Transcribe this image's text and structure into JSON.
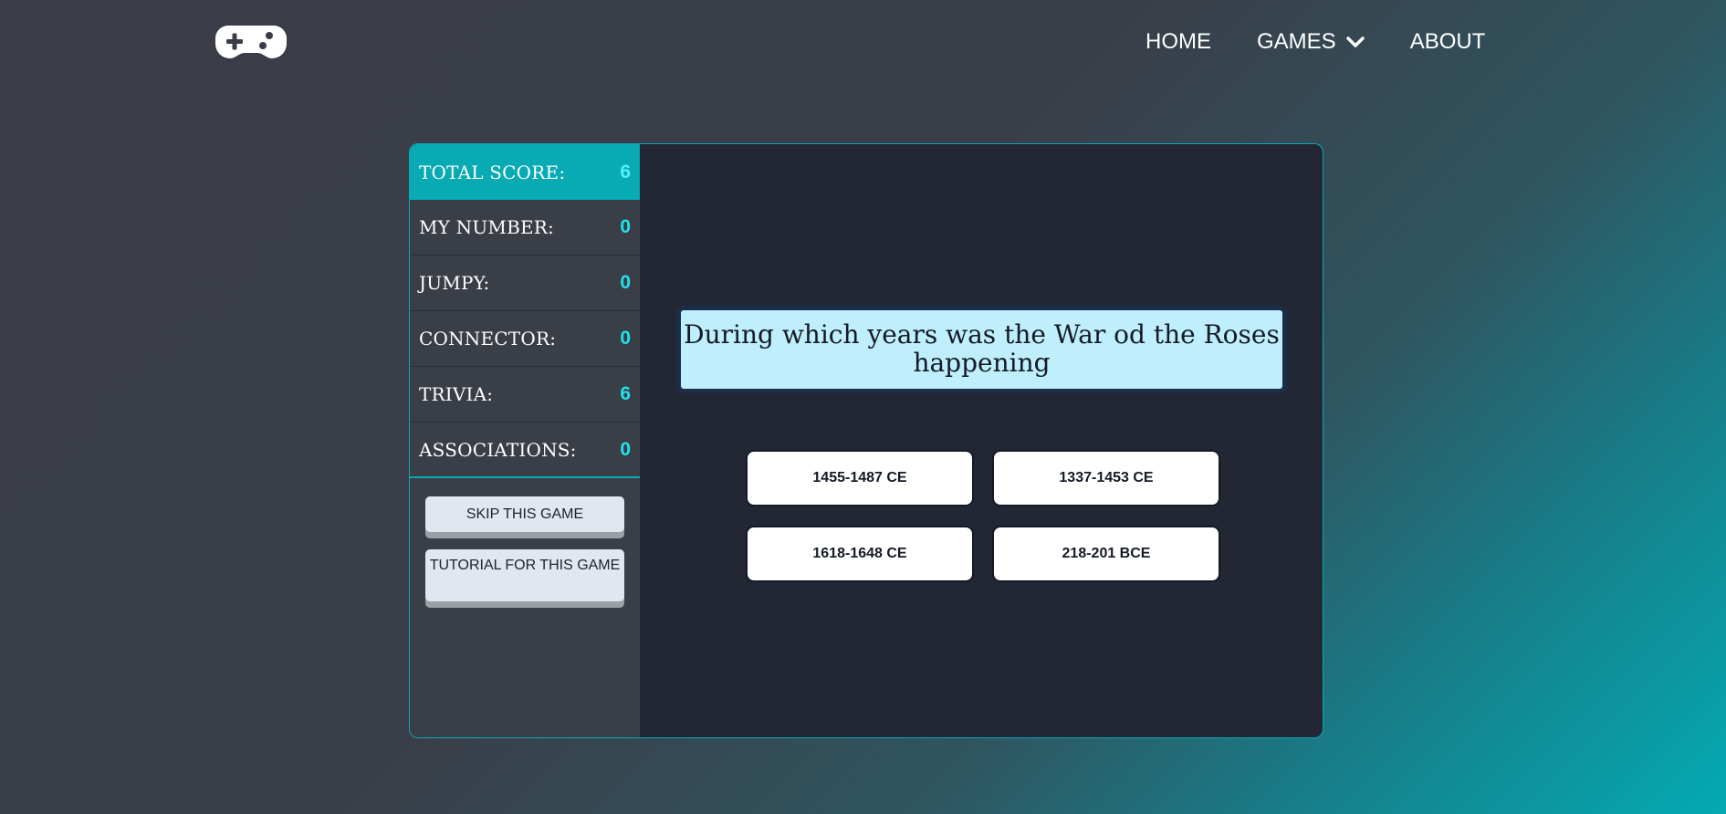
{
  "nav": {
    "home": "HOME",
    "games": "GAMES",
    "about": "ABOUT"
  },
  "scores": [
    {
      "label": "TOTAL SCORE:",
      "value": "6"
    },
    {
      "label": "MY NUMBER:",
      "value": "0"
    },
    {
      "label": "JUMPY:",
      "value": "0"
    },
    {
      "label": "CONNECTOR:",
      "value": "0"
    },
    {
      "label": "TRIVIA:",
      "value": "6"
    },
    {
      "label": "ASSOCIATIONS:",
      "value": "0"
    }
  ],
  "buttons": {
    "skip": "SKIP THIS GAME",
    "tutorial": "TUTORIAL FOR THIS GAME"
  },
  "question": "During which years was the War od the Roses happening",
  "answers": [
    "1455-1487 CE",
    "1337-1453 CE",
    "1618-1648 CE",
    "218-201 BCE"
  ],
  "colors": {
    "accent": "#08aab4",
    "score_value": "#1fe2ee",
    "question_bg": "#bfeffc"
  }
}
